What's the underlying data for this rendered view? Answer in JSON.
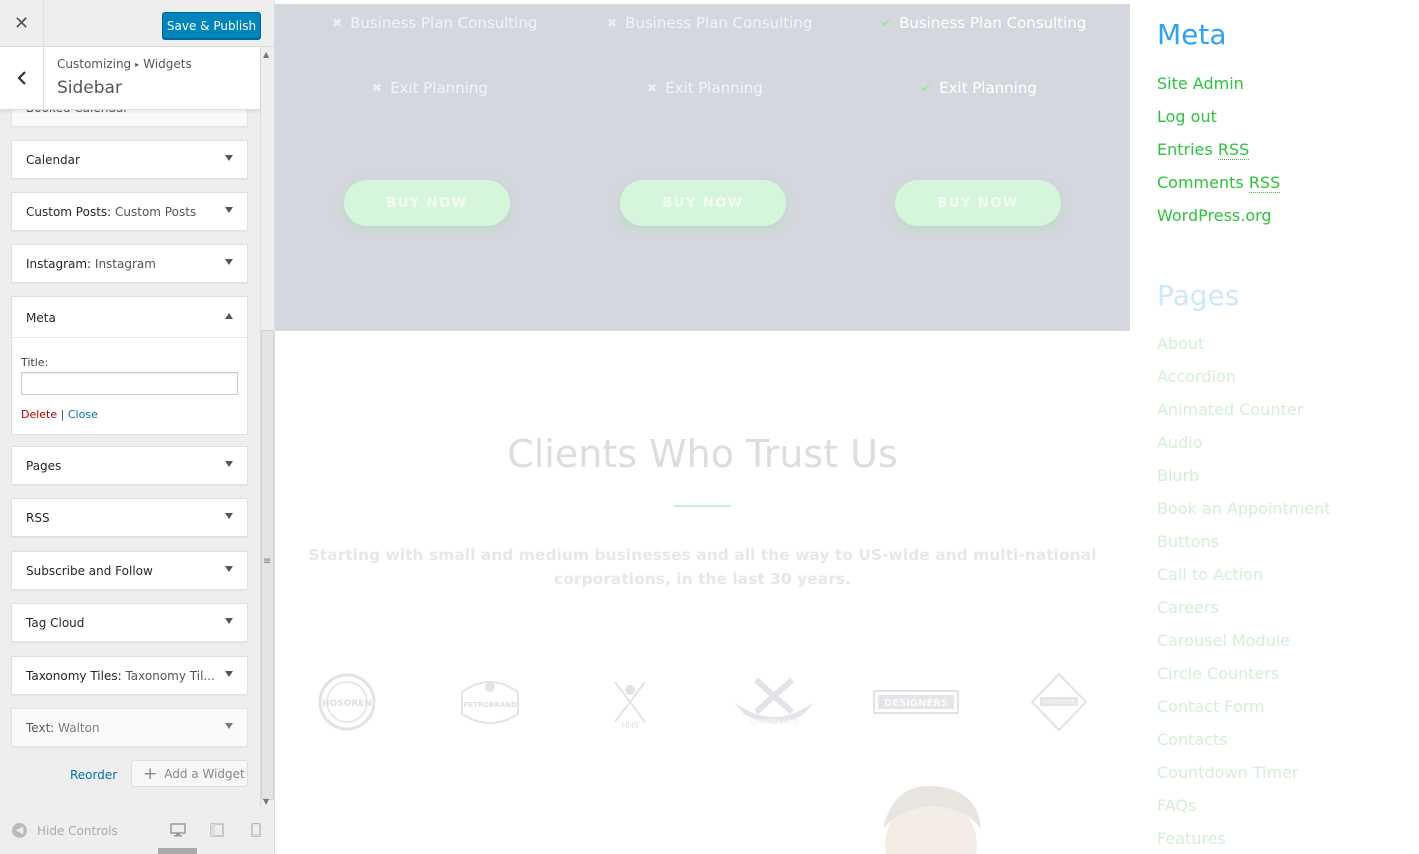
{
  "panel": {
    "close_glyph": "✕",
    "publish_label": "Save & Publish",
    "breadcrumb_parent": "Customizing",
    "breadcrumb_arrow": "▸",
    "breadcrumb_child": "Widgets",
    "section_title": "Sidebar",
    "widgets": [
      {
        "title": "Booked Calendar",
        "sub": ""
      },
      {
        "title": "Calendar",
        "sub": ""
      },
      {
        "title": "Custom Posts:",
        "sub": " Custom Posts"
      },
      {
        "title": "Instagram:",
        "sub": " Instagram"
      },
      {
        "title": "Meta",
        "sub": ""
      },
      {
        "title": "Pages",
        "sub": ""
      },
      {
        "title": "RSS",
        "sub": ""
      },
      {
        "title": "Subscribe and Follow",
        "sub": ""
      },
      {
        "title": "Tag Cloud",
        "sub": ""
      },
      {
        "title": "Taxonomy Tiles:",
        "sub": " Taxonomy Til..."
      },
      {
        "title": "Text:",
        "sub": " Walton"
      }
    ],
    "meta_form": {
      "title_label": "Title:",
      "title_value": "",
      "delete_label": "Delete",
      "separator": "|",
      "close_label": "Close"
    },
    "reorder_label": "Reorder",
    "add_widget_label": "Add a Widget",
    "hide_controls_label": "Hide Controls"
  },
  "preview": {
    "pricing": {
      "columns": [
        {
          "rows": [
            {
              "text": "Business Plan Consulting",
              "included": false
            },
            {
              "text": "Exit Planning",
              "included": false
            }
          ],
          "button": "BUY NOW"
        },
        {
          "rows": [
            {
              "text": "Business Plan Consulting",
              "included": false
            },
            {
              "text": "Exit Planning",
              "included": false
            }
          ],
          "button": "BUY NOW"
        },
        {
          "rows": [
            {
              "text": "Business Plan Consulting",
              "included": true
            },
            {
              "text": "Exit Planning",
              "included": true
            }
          ],
          "button": "BUY NOW"
        }
      ]
    },
    "clients_title": "Clients Who Trust Us",
    "clients_text": "Starting with small and medium businesses and all the way to US-wide and multi-national corporations, in the last 30 years.",
    "logos": [
      "HOSOREN",
      "PETROBRAND",
      "HHS",
      "SHOPBRAND",
      "DESIGNERS",
      "PROVIDENCE"
    ]
  },
  "sidebar": {
    "meta_heading": "Meta",
    "meta_links": [
      {
        "text": "Site Admin",
        "rss": ""
      },
      {
        "text": "Log out",
        "rss": ""
      },
      {
        "text": "Entries ",
        "rss": "RSS"
      },
      {
        "text": "Comments ",
        "rss": "RSS"
      },
      {
        "text": "WordPress.org",
        "rss": ""
      }
    ],
    "pages_heading": "Pages",
    "pages": [
      "About",
      "Accordion",
      "Animated Counter",
      "Audio",
      "Blurb",
      "Book an Appointment",
      "Buttons",
      "Call to Action",
      "Careers",
      "Carousel Module",
      "Circle Counters",
      "Contact Form",
      "Contacts",
      "Countdown Timer",
      "FAQs",
      "Features"
    ]
  },
  "colors": {
    "publish": "#0085ba",
    "accent_blue": "#2ea3f2",
    "link_green": "#2ec23d",
    "pricing_bg": "#d5d7de",
    "buy_button": "#d6f6dc"
  }
}
